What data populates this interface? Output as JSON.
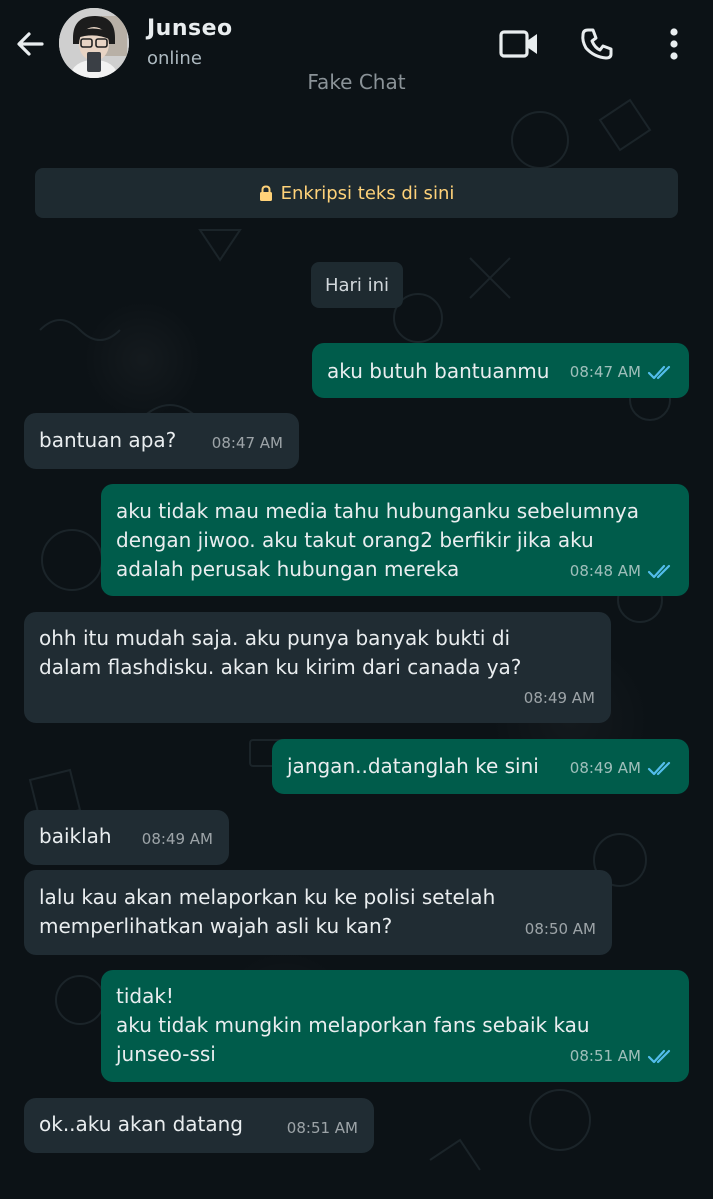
{
  "header": {
    "contact_name": "Junseo",
    "status": "online",
    "watermark": "Fake Chat",
    "icons": [
      "back-arrow-icon",
      "video-call-icon",
      "voice-call-icon",
      "more-options-icon"
    ]
  },
  "encryption_notice": "Enkripsi teks di sini",
  "date_chip": "Hari ini",
  "messages": [
    {
      "direction": "out",
      "text": "aku butuh bantuanmu",
      "time": "08:47 AM",
      "read": true
    },
    {
      "direction": "in",
      "text": "bantuan apa?",
      "time": "08:47 AM"
    },
    {
      "direction": "out",
      "text": "aku tidak mau media tahu hubunganku sebelumnya\ndengan jiwoo. aku takut orang2 berfikir jika aku\nadalah perusak hubungan mereka",
      "time": "08:48 AM",
      "read": true
    },
    {
      "direction": "in",
      "text": "ohh itu mudah saja. aku punya banyak bukti di\ndalam flashdisku. akan ku kirim dari canada ya?",
      "time": "08:49 AM"
    },
    {
      "direction": "out",
      "text": "jangan..datanglah ke sini",
      "time": "08:49 AM",
      "read": true
    },
    {
      "direction": "in",
      "text": "baiklah",
      "time": "08:49 AM"
    },
    {
      "direction": "in",
      "text": "lalu kau akan melaporkan ku ke polisi setelah\nmemperlihatkan wajah asli ku kan?",
      "time": "08:50 AM"
    },
    {
      "direction": "out",
      "text": "tidak!\naku tidak mungkin melaporkan fans sebaik kau\njunseo-ssi",
      "time": "08:51 AM",
      "read": true
    },
    {
      "direction": "in",
      "text": "ok..aku akan datang",
      "time": "08:51 AM"
    }
  ],
  "colors": {
    "background": "#0c1216",
    "incoming_bubble": "#202c33",
    "outgoing_bubble": "#005c4b",
    "encryption_text": "#ffd279",
    "read_ticks": "#53bdeb"
  }
}
